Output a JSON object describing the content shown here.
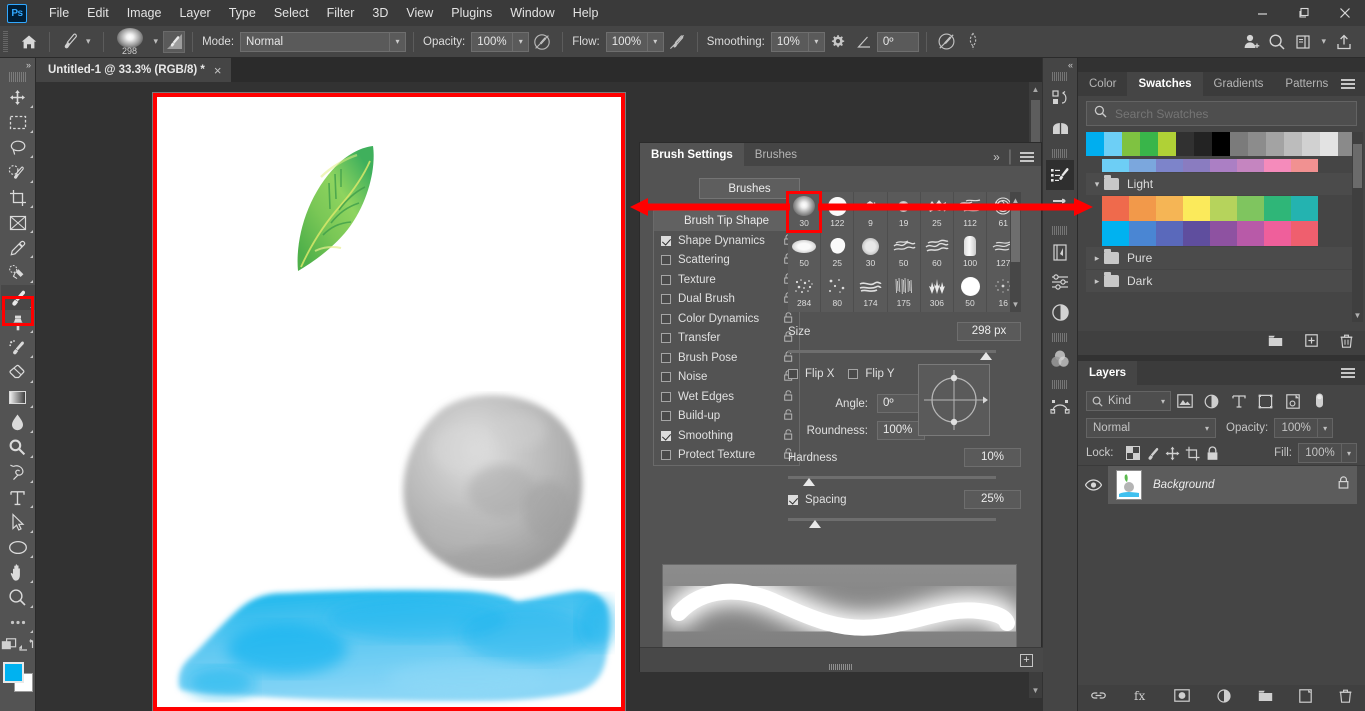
{
  "app": {
    "logo": "Ps",
    "title": "Adobe Photoshop"
  },
  "menubar": {
    "items": [
      "File",
      "Edit",
      "Image",
      "Layer",
      "Type",
      "Select",
      "Filter",
      "3D",
      "View",
      "Plugins",
      "Window",
      "Help"
    ]
  },
  "window_controls": {
    "minimize": "minimize-icon",
    "maximize": "maximize-icon",
    "close": "close-icon"
  },
  "options_bar": {
    "home_icon": "home-icon",
    "tool_icon": "brush-tool-icon",
    "brush_size_label": "298",
    "tilt_icon": "brush-pressure-icon",
    "mode_label": "Mode:",
    "mode_value": "Normal",
    "opacity_label": "Opacity:",
    "opacity_value": "100%",
    "opacity_pressure_icon": "pressure-opacity-icon",
    "flow_label": "Flow:",
    "flow_value": "100%",
    "airbrush_icon": "airbrush-icon",
    "smoothing_label": "Smoothing:",
    "smoothing_value": "10%",
    "gear_icon": "gear-icon",
    "angle_icon": "angle-icon",
    "angle_value": "0º",
    "symmetry_icon": "symmetry-icon",
    "tablet_pressure_icon": "tablet-pressure-icon",
    "right_icons": [
      "share-person-icon",
      "search-icon",
      "workspace-icon",
      "chevron-down-icon",
      "export-icon"
    ]
  },
  "document": {
    "tab_title": "Untitled-1 @ 33.3% (RGB/8) *",
    "close_icon": "close-icon"
  },
  "toolbar": {
    "collapse_icon": "double-chevron-icon",
    "tools": [
      {
        "name": "move-tool",
        "icon": "move-icon"
      },
      {
        "name": "rectangular-marquee-tool",
        "icon": "marquee-icon"
      },
      {
        "name": "lasso-tool",
        "icon": "lasso-icon"
      },
      {
        "name": "object-selection-tool",
        "icon": "quick-selection-icon"
      },
      {
        "name": "crop-tool",
        "icon": "crop-icon"
      },
      {
        "name": "frame-tool",
        "icon": "frame-icon"
      },
      {
        "name": "eyedropper-tool",
        "icon": "eyedropper-icon"
      },
      {
        "name": "spot-healing-brush-tool",
        "icon": "healing-brush-icon"
      },
      {
        "name": "brush-tool",
        "icon": "brush-icon",
        "selected": true
      },
      {
        "name": "clone-stamp-tool",
        "icon": "stamp-icon"
      },
      {
        "name": "history-brush-tool",
        "icon": "history-brush-icon"
      },
      {
        "name": "eraser-tool",
        "icon": "eraser-icon"
      },
      {
        "name": "gradient-tool",
        "icon": "gradient-icon"
      },
      {
        "name": "blur-tool",
        "icon": "blur-drop-icon"
      },
      {
        "name": "dodge-tool",
        "icon": "dodge-icon"
      },
      {
        "name": "pen-tool",
        "icon": "pen-icon"
      },
      {
        "name": "type-tool",
        "icon": "type-t-icon"
      },
      {
        "name": "path-selection-tool",
        "icon": "path-arrow-icon"
      },
      {
        "name": "ellipse-tool",
        "icon": "ellipse-icon"
      },
      {
        "name": "hand-tool",
        "icon": "hand-icon"
      },
      {
        "name": "zoom-tool",
        "icon": "magnifier-icon"
      },
      {
        "name": "edit-toolbar",
        "icon": "ellipsis-icon"
      }
    ],
    "quick_mask_icon": "quick-mask-icon",
    "screen-mode-icon": "screen-mode-icon",
    "foreground_color": "#00b2f0",
    "background_color": "#ffffff"
  },
  "canvas": {
    "zoom": "33.3%",
    "background": "#ffffff",
    "artwork": [
      "green-leaf",
      "gray-sphere",
      "blue-brush-stroke"
    ],
    "annotation_color": "#ff0000"
  },
  "brush_settings_panel": {
    "tabs": [
      {
        "label": "Brush Settings",
        "active": true
      },
      {
        "label": "Brushes",
        "active": false
      }
    ],
    "collapse_icon": "double-chevron-right-icon",
    "menu_icon": "panel-menu-icon",
    "brushes_button": "Brushes",
    "brush_tip_shape_header": "Brush Tip Shape",
    "dynamics": [
      {
        "label": "Shape Dynamics",
        "checked": true
      },
      {
        "label": "Scattering",
        "checked": false
      },
      {
        "label": "Texture",
        "checked": false
      },
      {
        "label": "Dual Brush",
        "checked": false
      },
      {
        "label": "Color Dynamics",
        "checked": false
      },
      {
        "label": "Transfer",
        "checked": false
      },
      {
        "label": "Brush Pose",
        "checked": false
      },
      {
        "label": "Noise",
        "checked": false
      },
      {
        "label": "Wet Edges",
        "checked": false
      },
      {
        "label": "Build-up",
        "checked": false
      },
      {
        "label": "Smoothing",
        "checked": true
      },
      {
        "label": "Protect Texture",
        "checked": false
      }
    ],
    "brush_presets": [
      [
        {
          "size": "30",
          "style": "soft-round",
          "selected": true
        },
        {
          "size": "122",
          "style": "hard-round"
        },
        {
          "size": "9",
          "style": "speckle-small"
        },
        {
          "size": "19",
          "style": "soft-dot"
        },
        {
          "size": "25",
          "style": "chalk-rough"
        },
        {
          "size": "112",
          "style": "scatter-dry"
        },
        {
          "size": "61",
          "style": "stipple-ball"
        }
      ],
      [
        {
          "size": "50",
          "style": "flat-oval"
        },
        {
          "size": "25",
          "style": "blob"
        },
        {
          "size": "30",
          "style": "rough-round"
        },
        {
          "size": "50",
          "style": "dry-brush"
        },
        {
          "size": "60",
          "style": "dry-brush-wide"
        },
        {
          "size": "100",
          "style": "flat-tip"
        },
        {
          "size": "127",
          "style": "scratchy"
        }
      ],
      [
        {
          "size": "284",
          "style": "spatter"
        },
        {
          "size": "80",
          "style": "sparse-dots"
        },
        {
          "size": "174",
          "style": "charcoal"
        },
        {
          "size": "175",
          "style": "hair-strands"
        },
        {
          "size": "306",
          "style": "grass"
        },
        {
          "size": "50",
          "style": "hard-round-2"
        },
        {
          "size": "16",
          "style": "fine-spatter"
        }
      ]
    ],
    "size_label": "Size",
    "size_value": "298 px",
    "flip_x_label": "Flip X",
    "flip_x_checked": false,
    "flip_y_label": "Flip Y",
    "flip_y_checked": false,
    "angle_label": "Angle:",
    "angle_value": "0º",
    "roundness_label": "Roundness:",
    "roundness_value": "100%",
    "hardness_label": "Hardness",
    "hardness_value": "10%",
    "spacing_label": "Spacing",
    "spacing_value": "25%",
    "spacing_checked": true,
    "add_preset_icon": "new-brush-preset-icon"
  },
  "icon_rail": {
    "collapse_icon": "double-chevron-left-icon",
    "icons": [
      {
        "name": "libraries-icon"
      },
      {
        "name": "adjustments-icon"
      },
      {
        "name": "brush-settings-icon",
        "active": true
      },
      {
        "name": "brushes-icon"
      },
      {
        "name": "history-icon"
      },
      {
        "name": "properties-icon"
      },
      {
        "name": "adjustments-circle-icon"
      },
      {
        "name": "channels-icon"
      },
      {
        "name": "paths-icon"
      }
    ]
  },
  "swatches_panel": {
    "tabs": [
      {
        "label": "Color",
        "active": false
      },
      {
        "label": "Swatches",
        "active": true
      },
      {
        "label": "Gradients",
        "active": false
      },
      {
        "label": "Patterns",
        "active": false
      }
    ],
    "menu_icon": "panel-menu-icon",
    "search_icon": "search-icon",
    "search_placeholder": "Search Swatches",
    "recent_row": [
      "#00aeef",
      "#6dcff6",
      "#7fc241",
      "#39b54a",
      "#b0d136",
      "#313131",
      "#232323",
      "#000000",
      "#7b7b7b",
      "#8c8c8c",
      "#a3a3a3",
      "#bcbcbc",
      "#d1d1d1",
      "#e3e3e3",
      "#8a8a8a"
    ],
    "partial_row": [
      "#6dcef5",
      "#7ba7dd",
      "#7d84ca",
      "#8a7cc0",
      "#ab7fc4",
      "#c585c0",
      "#f58bbb",
      "#f19191"
    ],
    "groups": [
      {
        "label": "Light",
        "expanded": true,
        "rows": [
          [
            "#ef6a4c",
            "#f2994a",
            "#f5b555",
            "#fbea5b",
            "#b6d35c",
            "#7fc55f",
            "#2fb678",
            "#24b3b0"
          ],
          [
            "#00b2f0",
            "#4a86d3",
            "#5a69bb",
            "#5f4e9e",
            "#8e52a1",
            "#b85aa8",
            "#ef5f9b",
            "#ef5f6e"
          ]
        ]
      },
      {
        "label": "Pure",
        "expanded": false
      },
      {
        "label": "Dark",
        "expanded": false
      }
    ],
    "footer_icons": [
      "new-group-icon",
      "new-swatch-icon",
      "delete-swatch-icon"
    ]
  },
  "layers_panel": {
    "tabs": [
      {
        "label": "Layers",
        "active": true
      }
    ],
    "menu_icon": "panel-menu-icon",
    "filter_kind_label": "Kind",
    "filter_icons": [
      "pixel-filter-icon",
      "adjustment-filter-icon",
      "type-filter-icon",
      "shape-filter-icon",
      "smart-object-filter-icon",
      "filter-toggle-icon"
    ],
    "blend_mode": "Normal",
    "opacity_label": "Opacity:",
    "opacity_value": "100%",
    "lock_label": "Lock:",
    "lock_icons": [
      "lock-transparency-icon",
      "lock-image-icon",
      "lock-position-icon",
      "lock-artboard-icon",
      "lock-all-icon"
    ],
    "fill_label": "Fill:",
    "fill_value": "100%",
    "layers": [
      {
        "name": "Background",
        "visible": true,
        "locked": true,
        "selected": true
      }
    ],
    "footer_icons": [
      "link-layers-icon",
      "layer-style-icon",
      "layer-mask-icon",
      "adjustment-layer-icon",
      "new-group-icon",
      "new-layer-icon",
      "delete-layer-icon"
    ]
  }
}
